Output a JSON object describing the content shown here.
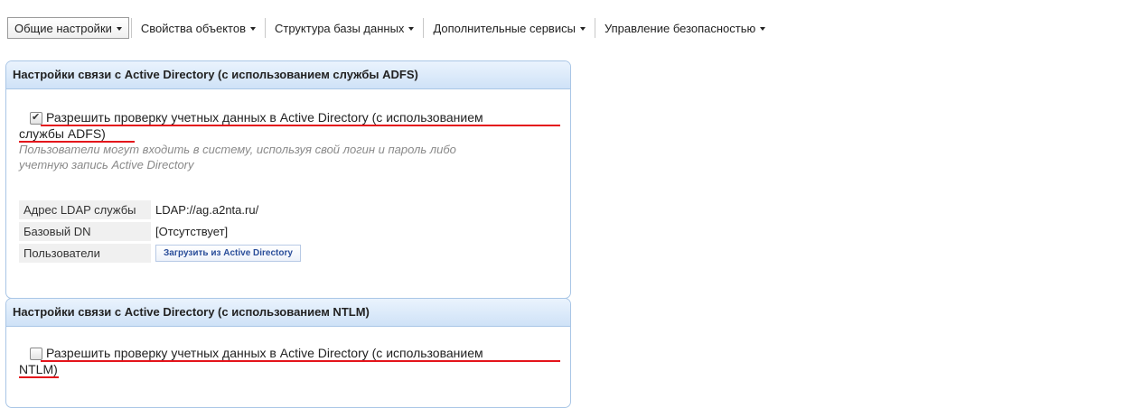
{
  "menu": [
    {
      "label": "Общие настройки",
      "active": true
    },
    {
      "label": "Свойства объектов",
      "active": false
    },
    {
      "label": "Структура базы данных",
      "active": false
    },
    {
      "label": "Дополнительные сервисы",
      "active": false
    },
    {
      "label": "Управление безопасностью",
      "active": false
    }
  ],
  "adfs": {
    "title": "Настройки связи с Active Directory (с использованием службы ADFS)",
    "checkbox_line1": "Разрешить проверку учетных данных в Active Directory (с использованием",
    "checkbox_line2": "службы ADFS)",
    "checked": true,
    "hint_line1": "Пользователи могут входить в систему, используя свой логин и пароль либо",
    "hint_line2": "учетную запись Active Directory",
    "rows": [
      {
        "key": "Адрес LDAP службы",
        "value": "LDAP://ag.a2nta.ru/"
      },
      {
        "key": "Базовый DN",
        "value": "[Отсутствует]"
      },
      {
        "key": "Пользователи",
        "button": "Загрузить из Active Directory"
      }
    ]
  },
  "ntlm": {
    "title": "Настройки связи с Active Directory (с использованием NTLM)",
    "checkbox_line1": "Разрешить проверку учетных данных в Active Directory (с использованием",
    "checkbox_line2": "NTLM)",
    "checked": false
  },
  "colors": {
    "highlight": "#e4141b",
    "panel_border": "#a9c6e6",
    "button_text": "#2a4e9a"
  }
}
